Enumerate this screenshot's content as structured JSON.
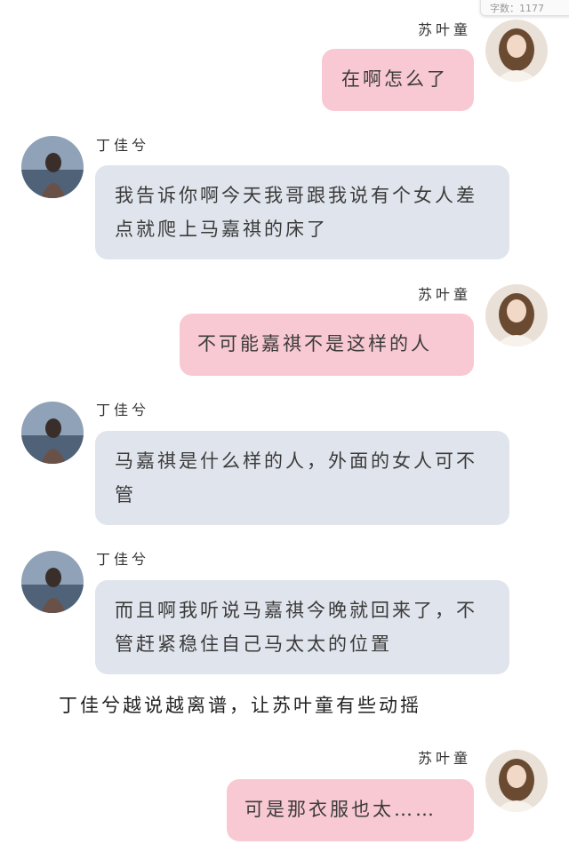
{
  "word_count_label": "字数：1177",
  "characters": {
    "right": "苏叶童",
    "left": "丁佳兮"
  },
  "messages": [
    {
      "side": "right",
      "name": "苏叶童",
      "text": "在啊怎么了"
    },
    {
      "side": "left",
      "name": "丁佳兮",
      "text": "我告诉你啊今天我哥跟我说有个女人差点就爬上马嘉祺的床了"
    },
    {
      "side": "right",
      "name": "苏叶童",
      "text": "不可能嘉祺不是这样的人"
    },
    {
      "side": "left",
      "name": "丁佳兮",
      "text": "马嘉祺是什么样的人，外面的女人可不管"
    },
    {
      "side": "left",
      "name": "丁佳兮",
      "text": "而且啊我听说马嘉祺今晚就回来了，不管赶紧稳住自己马太太的位置"
    },
    {
      "side": "right",
      "name": "苏叶童",
      "text": "可是那衣服也太……"
    }
  ],
  "narration": "丁佳兮越说越离谱，让苏叶童有些动摇",
  "colors": {
    "right_bubble": "#f8c9d2",
    "left_bubble": "#e0e4ec",
    "background": "#ffffff"
  }
}
